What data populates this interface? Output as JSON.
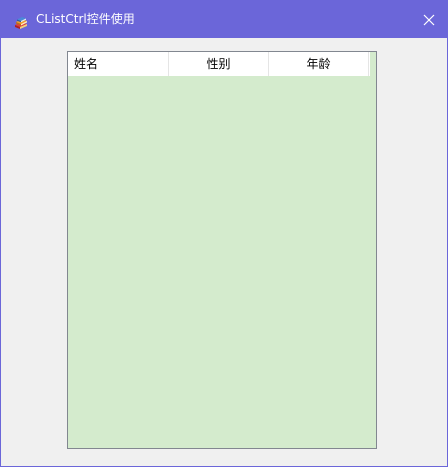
{
  "window": {
    "title": "CListCtrl控件使用",
    "icon": "app-books-icon",
    "close_icon": "close-icon",
    "titlebar_color": "#6b66d9"
  },
  "list": {
    "background_color": "#d4ebcd",
    "columns": [
      {
        "label": "姓名"
      },
      {
        "label": "性别"
      },
      {
        "label": "年龄"
      }
    ],
    "rows": []
  }
}
